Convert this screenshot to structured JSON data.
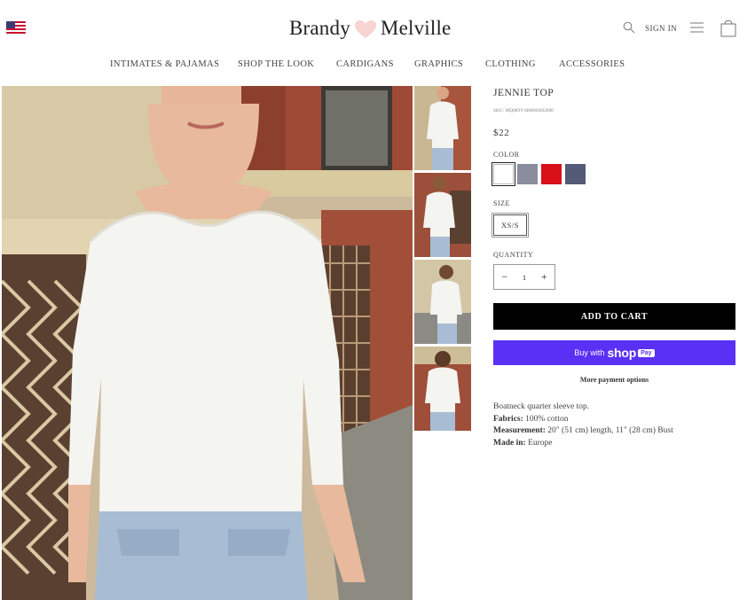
{
  "header": {
    "brand_left": "Brandy",
    "brand_right": "Melville",
    "sign_in": "SIGN IN"
  },
  "nav": [
    "INTIMATES & PAJAMAS",
    "SHOP THE LOOK",
    "CARDIGANS",
    "GRAPHICS",
    "CLOTHING",
    "ACCESSORIES"
  ],
  "product": {
    "title": "JENNIE TOP",
    "sku": "SKU: MQ089Y-6868S0202000",
    "price": "$22",
    "color_label": "COLOR",
    "colors": [
      "#ffffff",
      "#8a8d9c",
      "#d81018",
      "#525a78"
    ],
    "size_label": "SIZE",
    "size": "XS/S",
    "quantity_label": "QUANTITY",
    "quantity": "1",
    "minus": "−",
    "plus": "+",
    "add_to_cart": "ADD TO CART",
    "shop_pay": {
      "buy_with": "Buy with",
      "shop": "shop",
      "pay": "Pay"
    },
    "more_payment": "More payment options",
    "description": "Boatneck quarter sleeve top.",
    "fabrics_label": "Fabrics:",
    "fabrics": "100% cotton",
    "measurement_label": "Measurement:",
    "measurement": "20\" (51 cm) length, 11\" (28 cm) Bust",
    "made_in_label": "Made in:",
    "made_in": "Europe"
  },
  "icons": {
    "flag": "us-flag-icon",
    "search": "search-icon",
    "menu": "menu-icon",
    "bag": "shopping-bag-icon",
    "heart": "heart-icon"
  }
}
